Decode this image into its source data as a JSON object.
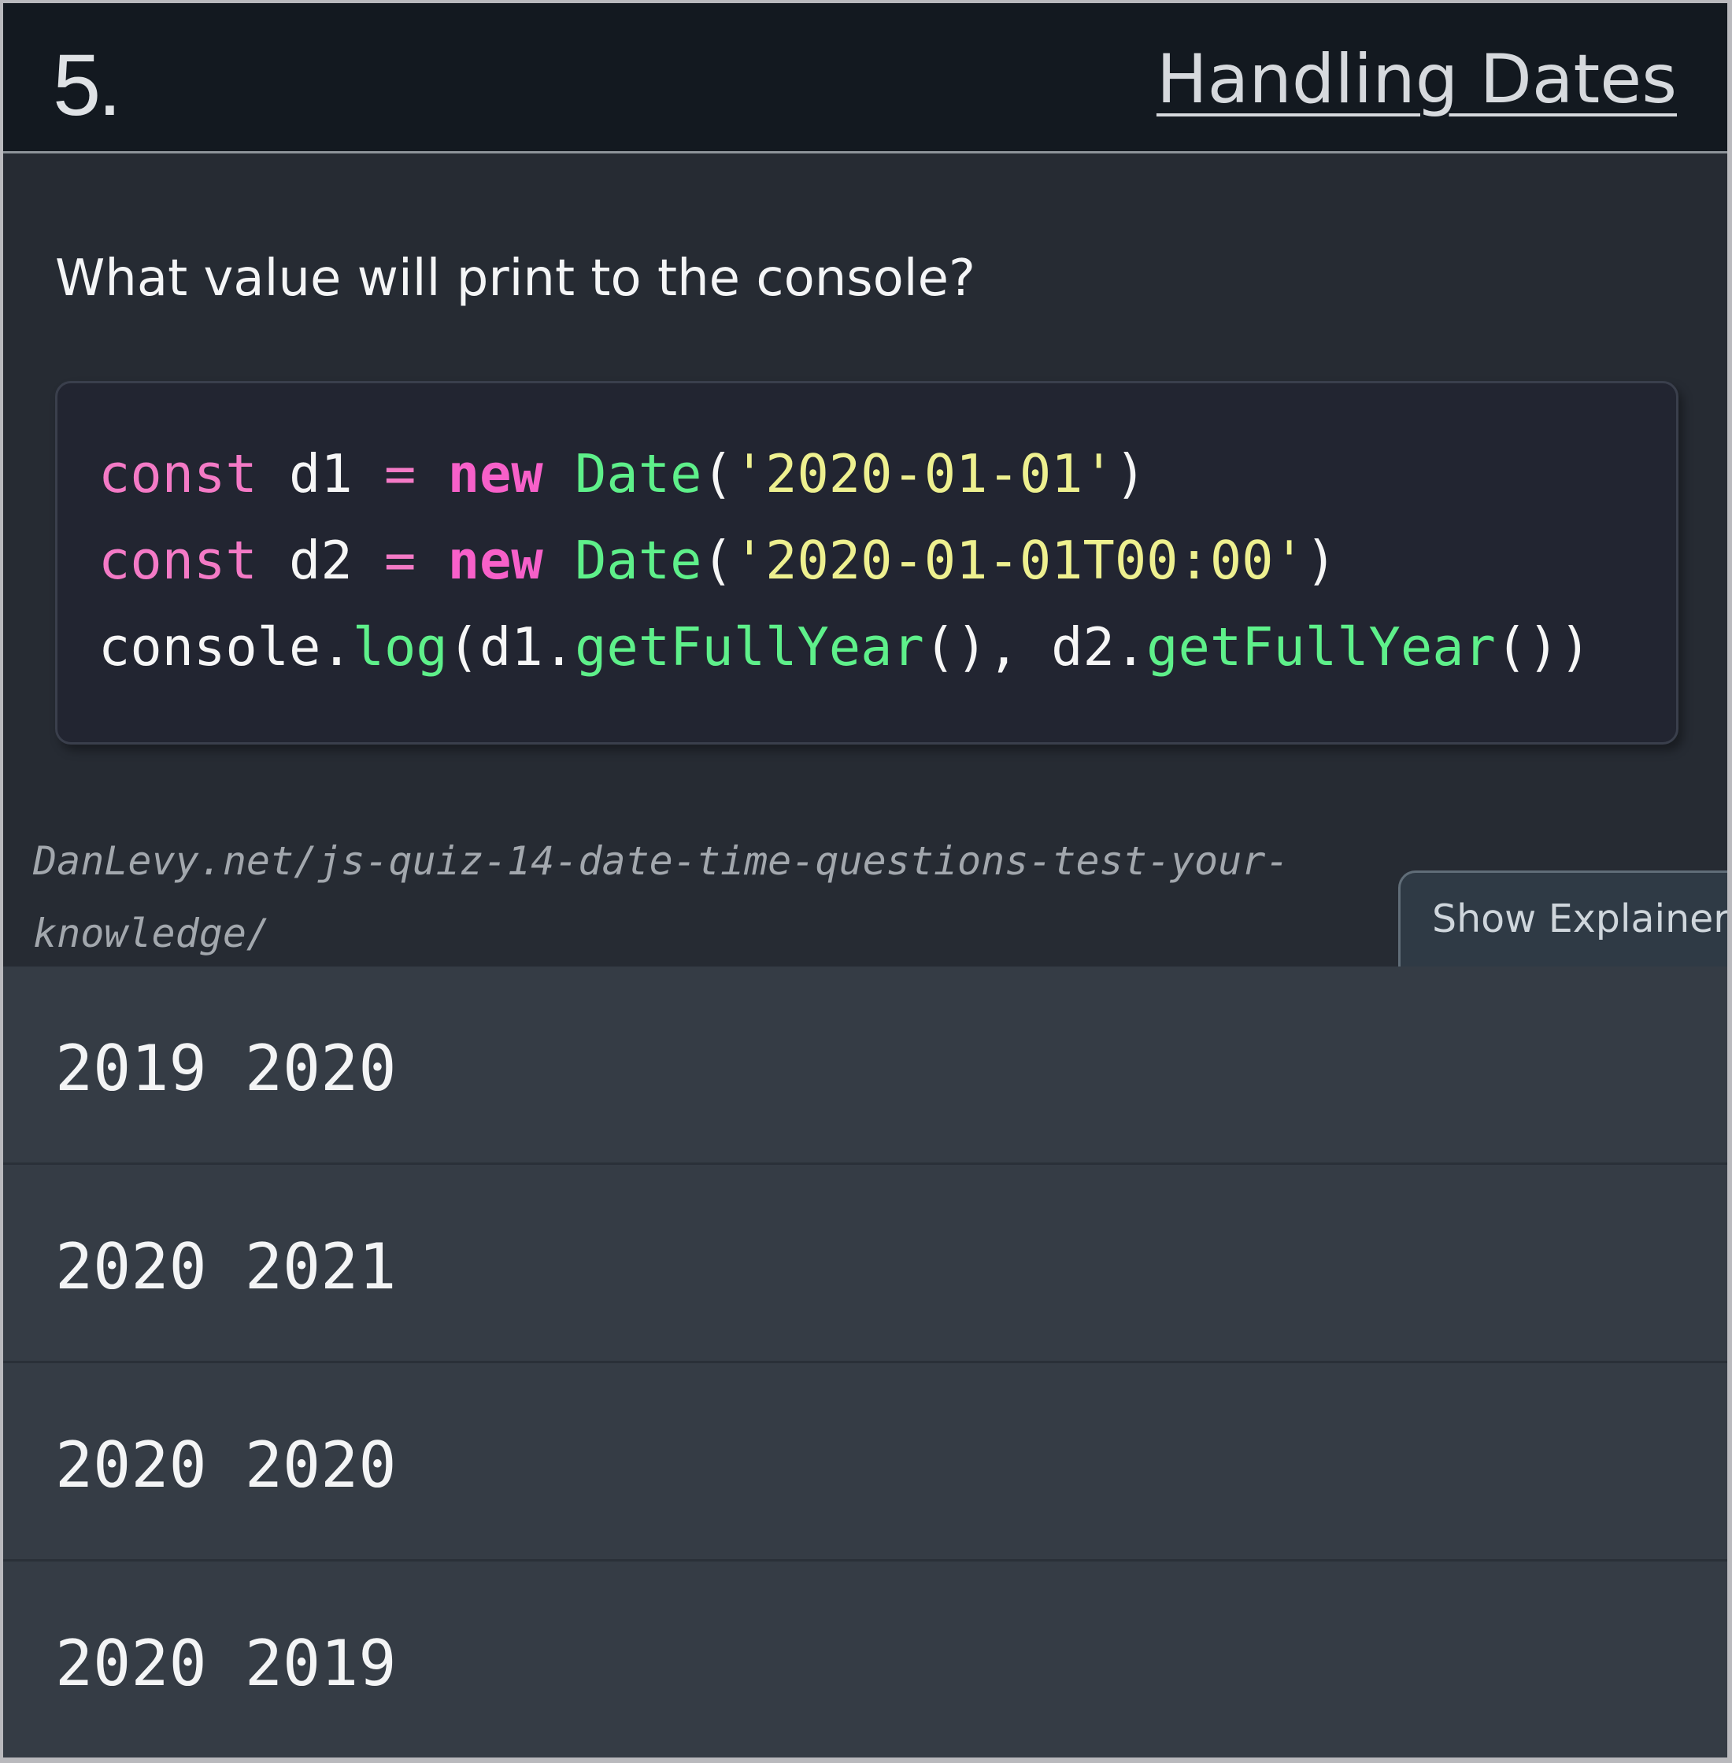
{
  "header": {
    "number": "5.",
    "title": "Handling Dates"
  },
  "question": "What value will print to the console?",
  "code": {
    "line1": {
      "kw": "const",
      "var": " d1 ",
      "eq": "= ",
      "new": "new",
      "fn": " Date",
      "open": "(",
      "str": "'2020-01-01'",
      "close": ")"
    },
    "line2": {
      "kw": "const",
      "var": " d2 ",
      "eq": "= ",
      "new": "new",
      "fn": " Date",
      "open": "(",
      "str": "'2020-01-01T00:00'",
      "close": ")"
    },
    "line3": {
      "obj": "console.",
      "fn1": "log",
      "mid1": "(d1.",
      "fn2": "getFullYear",
      "mid2": "(), d2.",
      "fn3": "getFullYear",
      "end": "())"
    }
  },
  "source_url": "DanLevy.net/js-quiz-14-date-time-questions-test-your-knowledge/",
  "explainer_button": "Show Explainer",
  "answers": [
    "2019 2020",
    "2020 2021",
    "2020 2020",
    "2020 2019"
  ]
}
